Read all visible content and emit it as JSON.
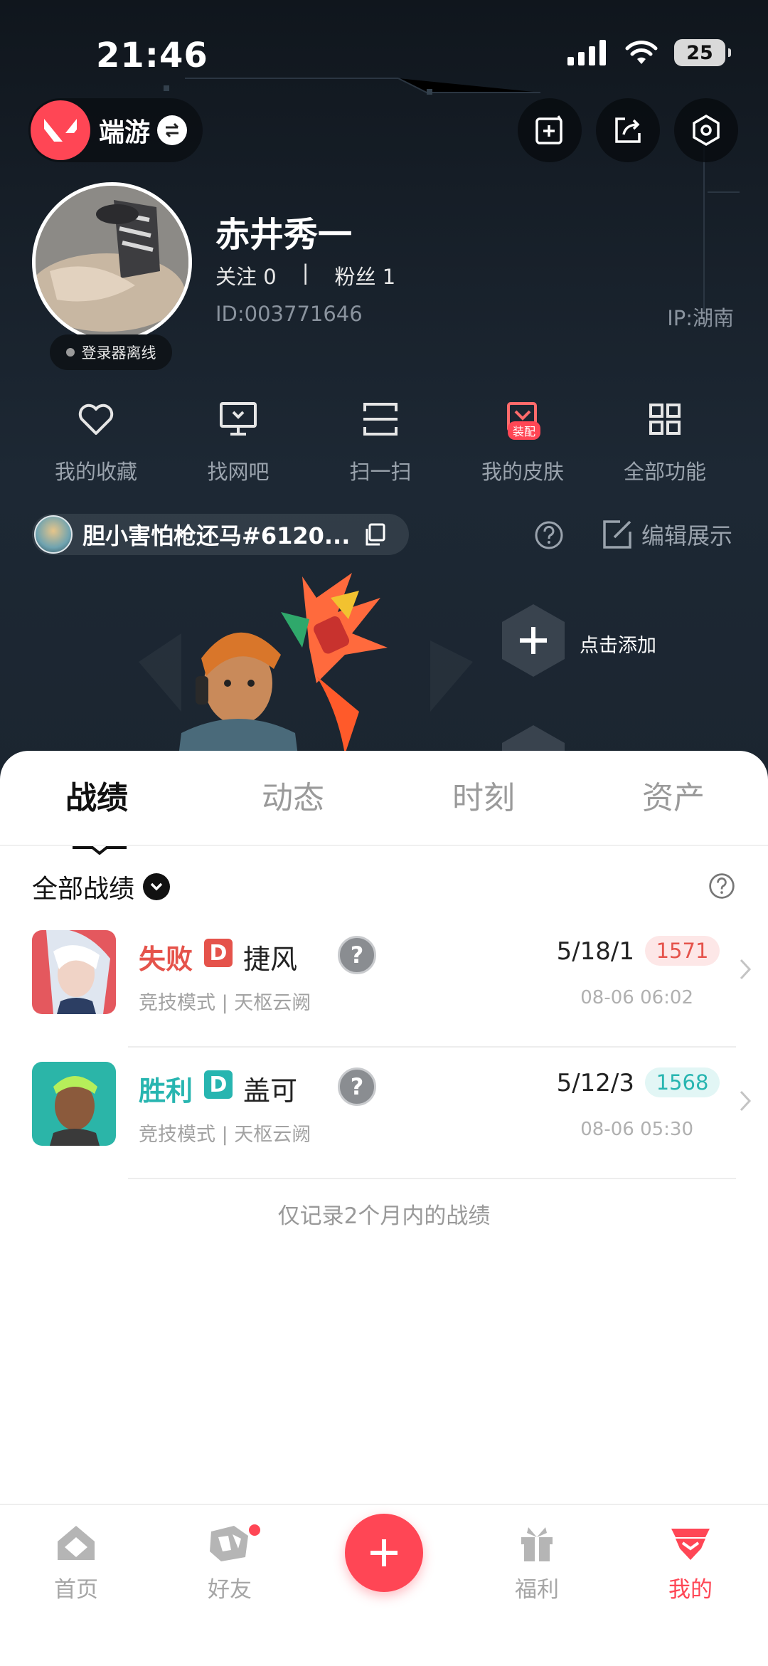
{
  "status_bar": {
    "time": "21:46",
    "battery": "25"
  },
  "header": {
    "game_name": "端游"
  },
  "profile": {
    "username": "赤井秀一",
    "follow_label": "关注",
    "follow_count": "0",
    "separator": "|",
    "fans_label": "粉丝",
    "fans_count": "1",
    "id_text": "ID:003771646",
    "ip_text": "IP:湖南",
    "online_status": "登录器离线"
  },
  "shortcuts": [
    {
      "label": "我的收藏",
      "icon": "heart-icon"
    },
    {
      "label": "找网吧",
      "icon": "monitor-icon"
    },
    {
      "label": "扫一扫",
      "icon": "scan-icon"
    },
    {
      "label": "我的皮肤",
      "icon": "skin-icon",
      "badge": "装配"
    },
    {
      "label": "全部功能",
      "icon": "grid-icon"
    }
  ],
  "riot_account": {
    "name": "胆小害怕枪还马#6120..."
  },
  "display": {
    "edit_label": "编辑展示",
    "add_label": "点击添加"
  },
  "tabs": [
    {
      "label": "战绩",
      "active": true
    },
    {
      "label": "动态",
      "active": false
    },
    {
      "label": "时刻",
      "active": false
    },
    {
      "label": "资产",
      "active": false
    }
  ],
  "filter": {
    "label": "全部战绩"
  },
  "matches": [
    {
      "result": "失败",
      "result_color": "#e5534b",
      "rank": "D",
      "rank_color": "#e5534b",
      "agent": "捷风",
      "mode": "竞技模式 | 天枢云阙",
      "kda": "5/18/1",
      "rating": "1571",
      "rating_bg": "#fde7e7",
      "rating_color": "#e5534b",
      "time": "08-06 06:02"
    },
    {
      "result": "胜利",
      "result_color": "#27b5b0",
      "rank": "D",
      "rank_color": "#27b5b0",
      "agent": "盖可",
      "mode": "竞技模式 | 天枢云阙",
      "kda": "5/12/3",
      "rating": "1568",
      "rating_bg": "#e2f6f5",
      "rating_color": "#27b5b0",
      "time": "08-06 05:30"
    }
  ],
  "footer_note": "仅记录2个月内的战绩",
  "bottom_nav": [
    {
      "label": "首页",
      "icon": "home-icon",
      "active": false
    },
    {
      "label": "好友",
      "icon": "friends-icon",
      "active": false,
      "dot": true
    },
    {
      "label": "福利",
      "icon": "gift-icon",
      "active": false
    },
    {
      "label": "我的",
      "icon": "profile-icon",
      "active": true
    }
  ],
  "colors": {
    "accent": "#ff4655",
    "dark_bg": "#18212b"
  }
}
